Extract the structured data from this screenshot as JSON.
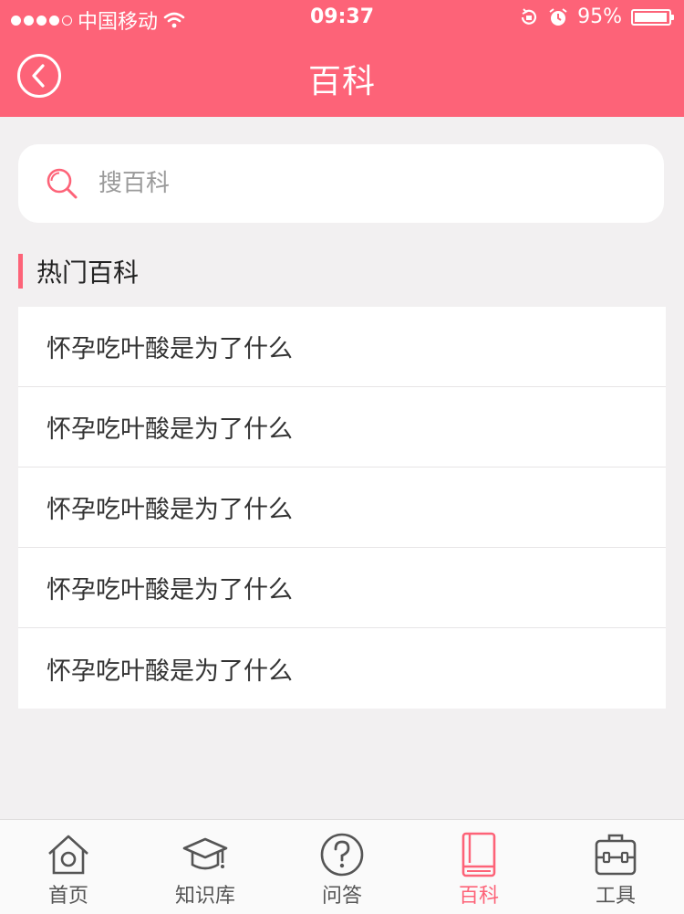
{
  "status_bar": {
    "carrier": "中国移动",
    "time": "09:37",
    "battery": "95%"
  },
  "header": {
    "title": "百科",
    "back_icon": "back-circle-icon"
  },
  "search": {
    "placeholder": "搜百科",
    "value": ""
  },
  "section": {
    "title": "热门百科"
  },
  "list": {
    "items": [
      {
        "label": "怀孕吃叶酸是为了什么"
      },
      {
        "label": "怀孕吃叶酸是为了什么"
      },
      {
        "label": "怀孕吃叶酸是为了什么"
      },
      {
        "label": "怀孕吃叶酸是为了什么"
      },
      {
        "label": "怀孕吃叶酸是为了什么"
      }
    ]
  },
  "tabbar": {
    "active_index": 3,
    "tabs": [
      {
        "label": "首页",
        "icon": "home-icon"
      },
      {
        "label": "知识库",
        "icon": "graduation-cap-icon"
      },
      {
        "label": "问答",
        "icon": "question-icon"
      },
      {
        "label": "百科",
        "icon": "book-icon"
      },
      {
        "label": "工具",
        "icon": "toolbox-icon"
      }
    ]
  },
  "colors": {
    "accent": "#fd6378",
    "background": "#f2f0f1",
    "tab_inactive": "#555555"
  }
}
